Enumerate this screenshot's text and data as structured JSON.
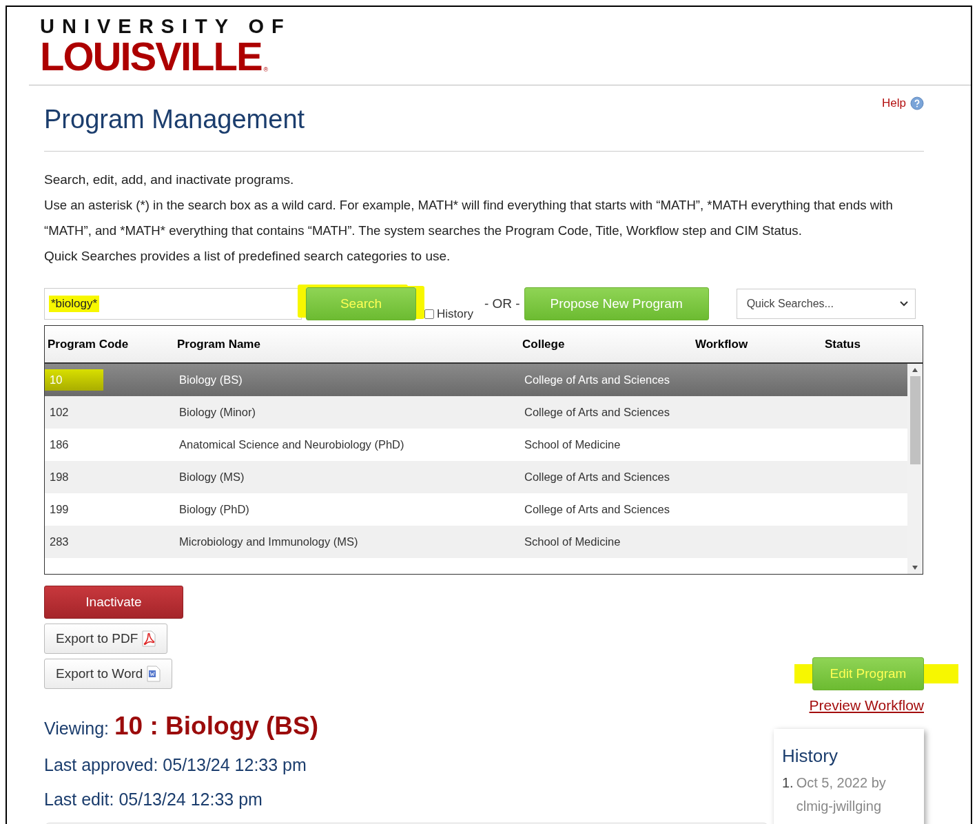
{
  "logo": {
    "line1": "UNIVERSITY OF",
    "line2": "LOUISVILLE",
    "mark": "®"
  },
  "help": {
    "label": "Help"
  },
  "title": "Program Management",
  "intro": [
    "Search, edit, add, and inactivate programs.",
    "Use an asterisk (*) in the search box as a wild card. For example, MATH* will find everything that starts with “MATH”, *MATH everything that ends with “MATH”, and *MATH* everything that contains “MATH”. The system searches the Program Code, Title, Workflow step and CIM Status.",
    "Quick Searches provides a list of predefined search categories to use."
  ],
  "search": {
    "value": "*biology*",
    "highlighted": true
  },
  "search_button": {
    "label": "Search",
    "highlighted": true
  },
  "history_checkbox": {
    "label": "History",
    "checked": false
  },
  "or_label": "- OR -",
  "propose_button": {
    "label": "Propose New Program"
  },
  "quick_searches": {
    "placeholder": "Quick Searches..."
  },
  "table": {
    "columns": [
      "Program Code",
      "Program Name",
      "College",
      "Workflow",
      "Status"
    ],
    "rows": [
      {
        "code": "10",
        "name": "Biology (BS)",
        "college": "College of Arts and Sciences",
        "selected": true,
        "highlighted": true
      },
      {
        "code": "102",
        "name": "Biology (Minor)",
        "college": "College of Arts and Sciences",
        "selected": false,
        "highlighted": false
      },
      {
        "code": "186",
        "name": "Anatomical Science and Neurobiology (PhD)",
        "college": "School of Medicine",
        "selected": false,
        "highlighted": false
      },
      {
        "code": "198",
        "name": "Biology (MS)",
        "college": "College of Arts and Sciences",
        "selected": false,
        "highlighted": false
      },
      {
        "code": "199",
        "name": "Biology (PhD)",
        "college": "College of Arts and Sciences",
        "selected": false,
        "highlighted": false
      },
      {
        "code": "283",
        "name": "Microbiology and Immunology (MS)",
        "college": "School of Medicine",
        "selected": false,
        "highlighted": false
      }
    ]
  },
  "inactivate_button": {
    "label": "Inactivate"
  },
  "export_buttons": [
    {
      "label": "Export to PDF",
      "kind": "pdf"
    },
    {
      "label": "Export to Word",
      "kind": "word"
    }
  ],
  "edit_button": {
    "label": "Edit Program",
    "highlighted": true
  },
  "preview_link": "Preview Workflow",
  "viewing": {
    "label": "Viewing:",
    "value": "10 : Biology (BS)"
  },
  "last_approved": "Last approved: 05/13/24 12:33 pm",
  "last_edit": "Last edit: 05/13/24 12:33 pm",
  "history_panel": {
    "title": "History",
    "entries": [
      {
        "number": "1.",
        "text": "Oct 5, 2022 by clmig-jwillging"
      }
    ]
  }
}
